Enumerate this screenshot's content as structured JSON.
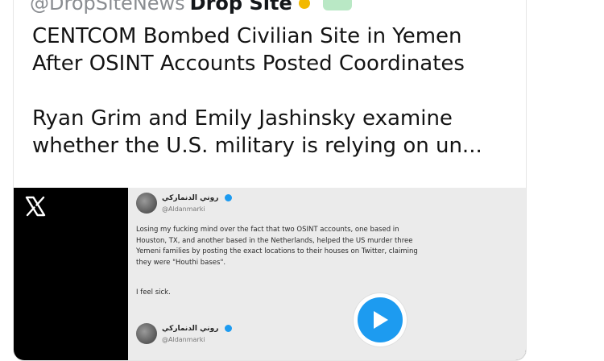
{
  "header": {
    "handle": "@DropSiteNews",
    "name": "Drop Site"
  },
  "tweet": {
    "text": "CENTCOM Bombed Civilian Site in Yemen\nAfter OSINT Accounts Posted Coordinates\n\nRyan Grim and Emily Jashinsky examine\nwhether the U.S. military is relying on un..."
  },
  "media": {
    "icons": {
      "logo": "x-logo-icon",
      "play": "play-icon"
    },
    "embedded_post": {
      "author_name": "روني الدنماركي",
      "author_handle": "@Aldanmarki",
      "body": "Losing my fucking mind over the fact that two OSINT accounts, one based in Houston, TX, and another based in the Netherlands, helped the US murder three Yemeni families by posting the exact locations to their houses on Twitter, claiming they were \"Houthi bases\".",
      "followup": "I feel sick.",
      "author_name_2": "روني الدنماركي",
      "author_handle_2": "@Aldanmarki"
    }
  },
  "colors": {
    "accent": "#1d9bf0",
    "media_bg": "#000000",
    "embed_bg": "#ebebeb"
  }
}
